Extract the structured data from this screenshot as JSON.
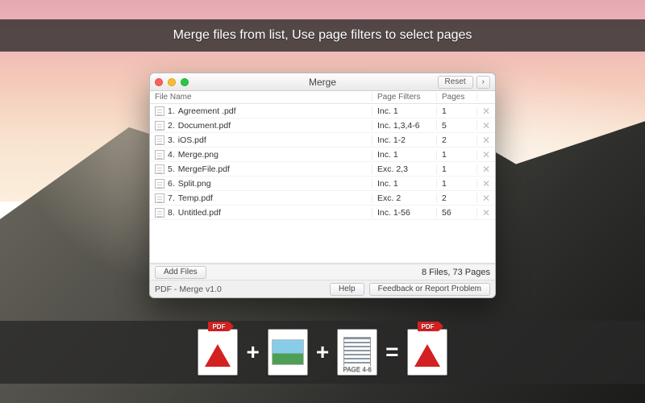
{
  "banner_text": "Merge files from list, Use page filters to select pages",
  "window": {
    "title": "Merge",
    "reset_label": "Reset",
    "chevron": "›",
    "columns": {
      "name": "File Name",
      "filter": "Page Filters",
      "pages": "Pages"
    },
    "rows": [
      {
        "idx": "1.",
        "name": "Agreement .pdf",
        "filter": "Inc. 1",
        "pages": "1"
      },
      {
        "idx": "2.",
        "name": "Document.pdf",
        "filter": "Inc. 1,3,4-6",
        "pages": "5"
      },
      {
        "idx": "3.",
        "name": "iOS.pdf",
        "filter": "Inc. 1-2",
        "pages": "2"
      },
      {
        "idx": "4.",
        "name": "Merge.png",
        "filter": "Inc. 1",
        "pages": "1"
      },
      {
        "idx": "5.",
        "name": "MergeFile.pdf",
        "filter": "Exc. 2,3",
        "pages": "1"
      },
      {
        "idx": "6.",
        "name": "Split.png",
        "filter": "Inc. 1",
        "pages": "1"
      },
      {
        "idx": "7.",
        "name": "Temp.pdf",
        "filter": "Exc. 2",
        "pages": "2"
      },
      {
        "idx": "8.",
        "name": "Untitled.pdf",
        "filter": "Inc. 1-56",
        "pages": "56"
      }
    ],
    "add_files_label": "Add Files",
    "status_right": "8 Files, 73 Pages",
    "app_version": "PDF - Merge v1.0",
    "help_label": "Help",
    "feedback_label": "Feedback or Report Problem"
  },
  "equation": {
    "pdf_tab": "PDF",
    "page_sub": "PAGE 4-6",
    "plus": "+",
    "equals": "="
  }
}
